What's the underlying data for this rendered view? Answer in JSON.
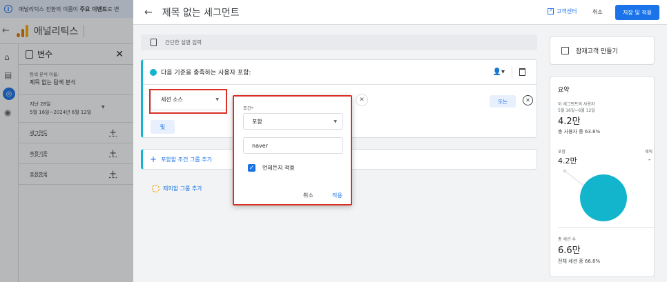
{
  "background_app": {
    "banner_prefix": "애널리틱스 전환의 이름이",
    "banner_bold": "주요 이벤트",
    "banner_suffix": "로 변",
    "app_title": "애널리틱스",
    "vars_title": "변수",
    "exploration_label": "탐색 분석 이름:",
    "exploration_name": "제목 없는 탐색 분석",
    "date_label": "지난 28일",
    "date_range": "5월 16일~2024년 6월 12일",
    "rows": [
      "세그먼트",
      "측정기준",
      "측정항목"
    ]
  },
  "builder": {
    "title": "제목 없는 세그먼트",
    "help_label": "고객센터",
    "cancel_label": "취소",
    "save_label": "저장 및 적용",
    "description_placeholder": "간단한 설명 입력",
    "condition_group_label": "다음 기준을 충족하는 사용자 포함:",
    "dimension_value": "세션 소스",
    "or_label": "또는",
    "and_label": "및",
    "add_group_label": "포함할 조건 그룹 추가",
    "add_exclude_label": "제외할 그룹 추가"
  },
  "popover": {
    "condition_label": "조건*",
    "operator_value": "포함",
    "input_value": "naver",
    "checkbox_label": "언제든지 적용",
    "cancel_label": "취소",
    "apply_label": "적용"
  },
  "summary": {
    "audience_label": "잠재고객 만들기",
    "title": "요약",
    "users_caption": "이 세그먼트의 사용자",
    "users_date": "5월 16일~6월 12일",
    "users_value": "4.2만",
    "users_share": "총 사용자 중 63.8%",
    "include_label": "포함",
    "exclude_label": "제외",
    "include_value": "4.2만",
    "exclude_value": "-",
    "sessions_caption": "총 세션 수",
    "sessions_value": "6.6만",
    "sessions_share": "전체 세션 중 66.8%",
    "accent_color": "#12b5cb"
  }
}
